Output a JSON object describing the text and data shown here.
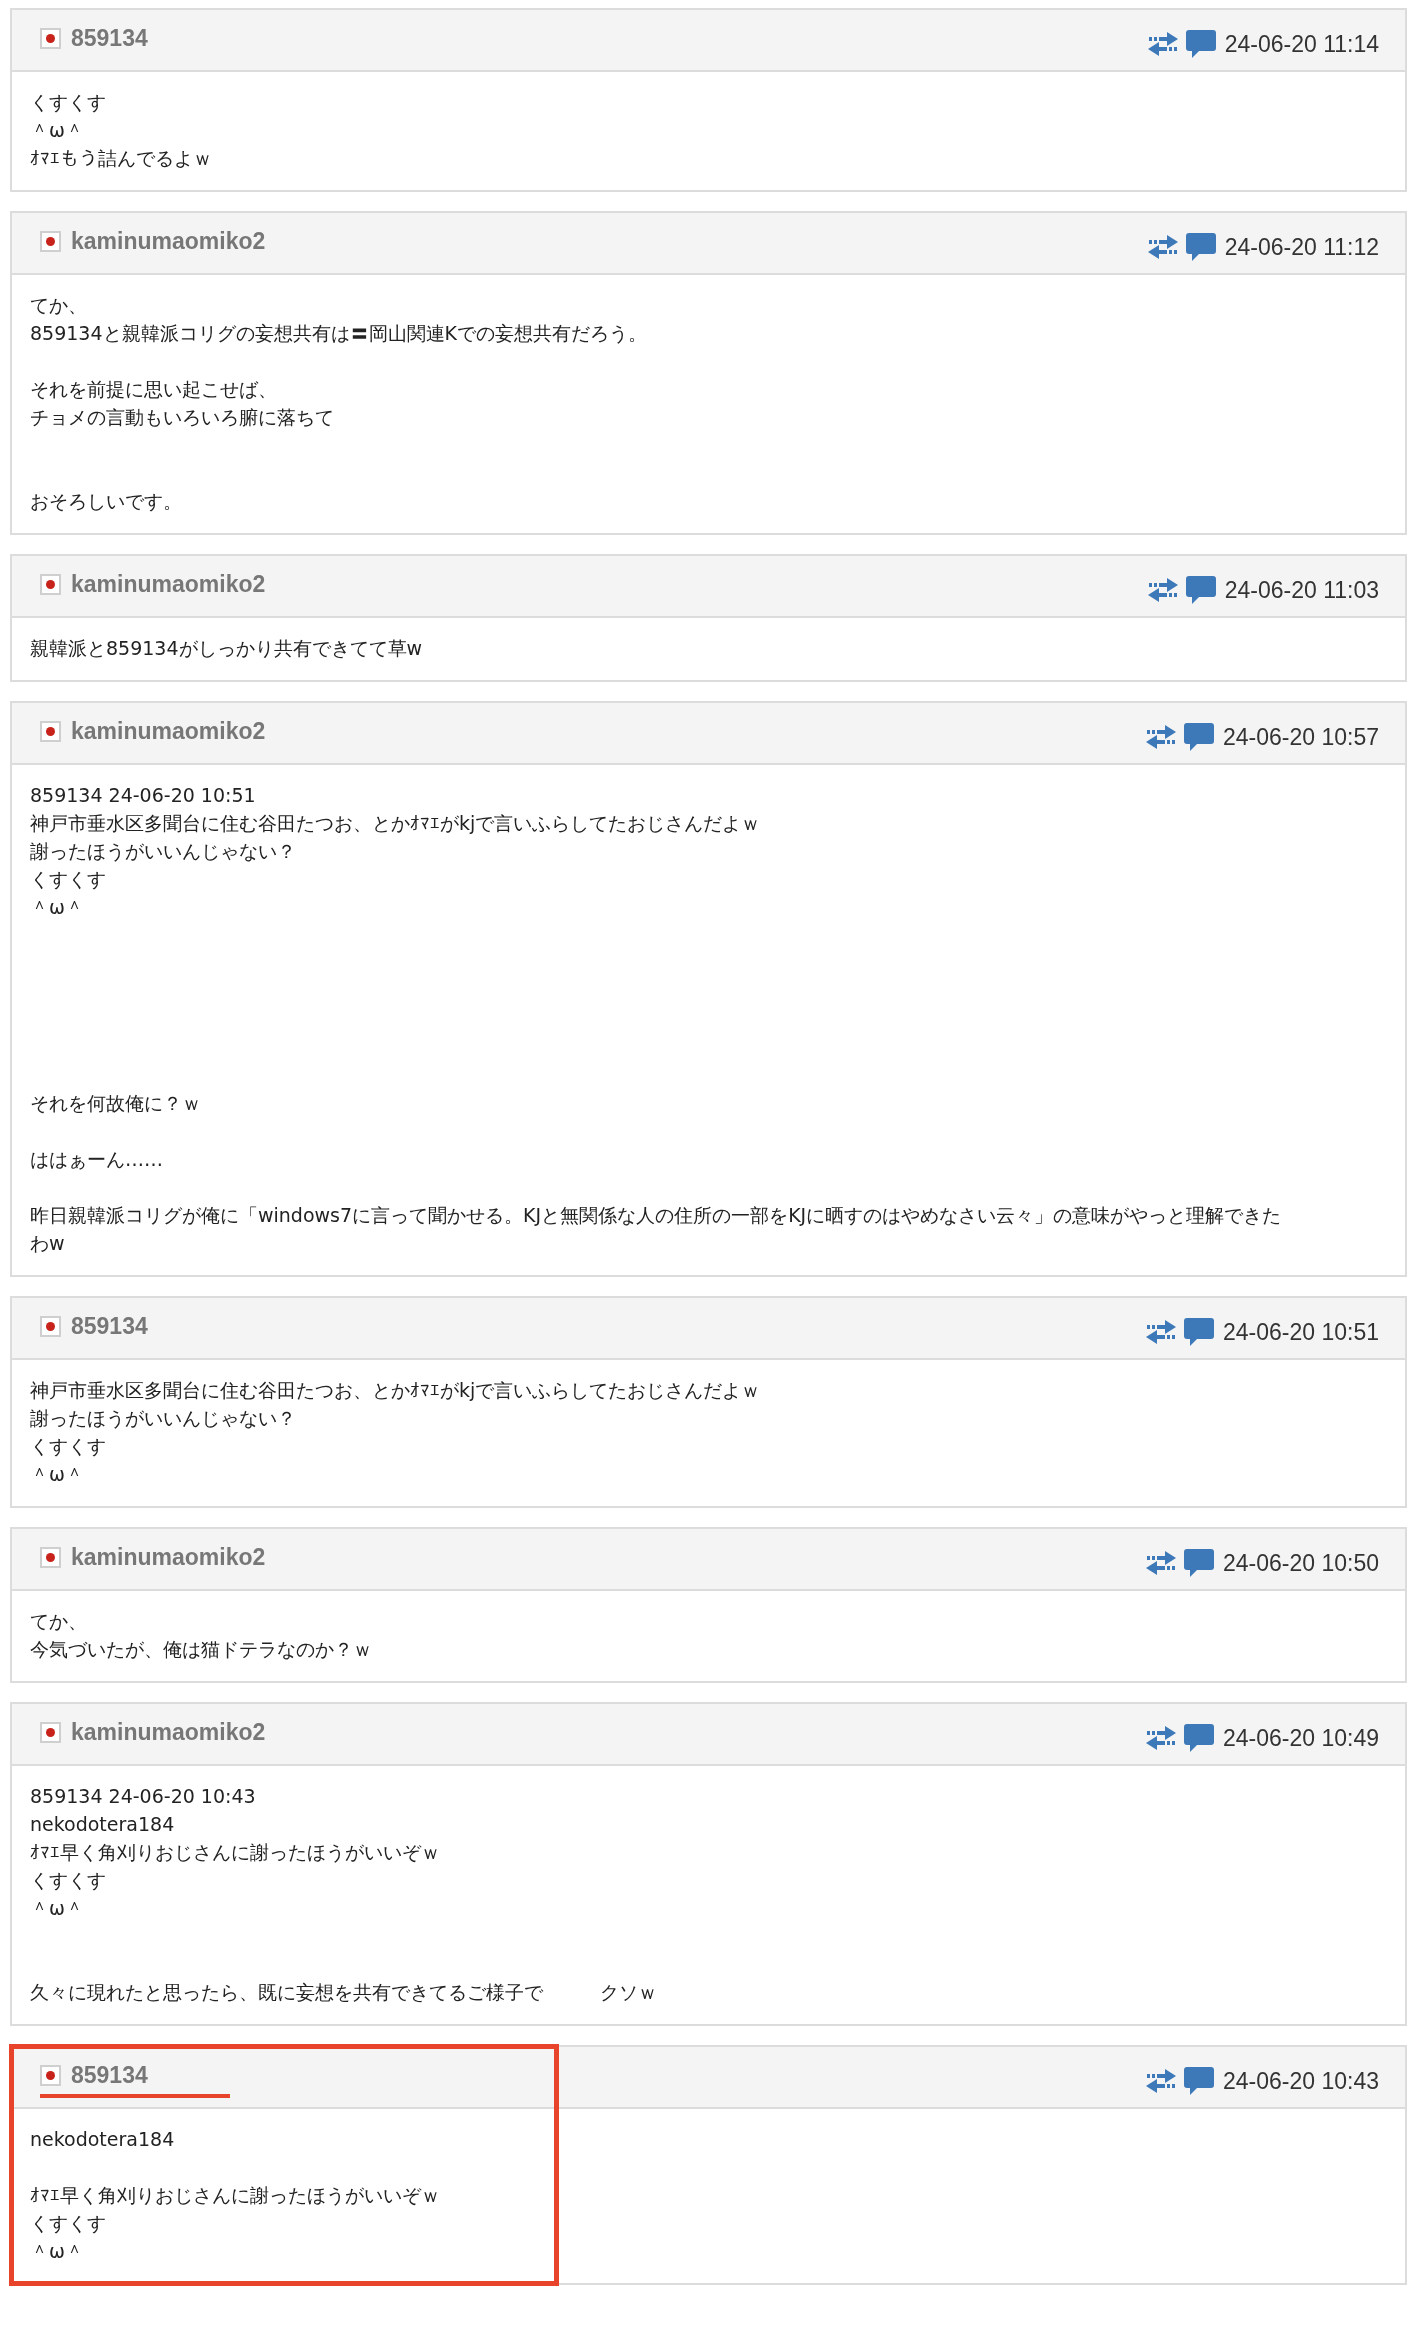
{
  "posts": [
    {
      "user": "859134",
      "date": "24-06-20 11:14",
      "highlighted": false,
      "lines": [
        {
          "kind": "text",
          "text": "くすくす"
        },
        {
          "kind": "text",
          "text": "＾ω＾"
        },
        {
          "kind": "text",
          "text": "ｵﾏｴもう詰んでるよｗ"
        }
      ]
    },
    {
      "user": "kaminumaomiko2",
      "date": "24-06-20 11:12",
      "highlighted": false,
      "lines": [
        {
          "kind": "text",
          "text": "てか、"
        },
        {
          "kind": "text",
          "text": "859134と親韓派コリグの妄想共有は〓岡山関連Kでの妄想共有だろう。"
        },
        {
          "kind": "blank"
        },
        {
          "kind": "text",
          "text": "それを前提に思い起こせば、"
        },
        {
          "kind": "text",
          "text": "チョメの言動もいろいろ腑に落ちて"
        },
        {
          "kind": "blank"
        },
        {
          "kind": "blank"
        },
        {
          "kind": "text",
          "text": "おそろしいです。"
        }
      ]
    },
    {
      "user": "kaminumaomiko2",
      "date": "24-06-20 11:03",
      "highlighted": false,
      "lines": [
        {
          "kind": "text",
          "text": "親韓派と859134がしっかり共有できてて草w"
        }
      ]
    },
    {
      "user": "kaminumaomiko2",
      "date": "24-06-20 10:57",
      "highlighted": false,
      "lines": [
        {
          "kind": "text",
          "text": "859134 24-06-20 10:51"
        },
        {
          "kind": "text",
          "text": "神戸市垂水区多聞台に住む谷田たつお、とかｵﾏｴがkjで言いふらしてたおじさんだよｗ"
        },
        {
          "kind": "text",
          "text": "謝ったほうがいいんじゃない？"
        },
        {
          "kind": "text",
          "text": "くすくす"
        },
        {
          "kind": "text",
          "text": "＾ω＾"
        },
        {
          "kind": "blank"
        },
        {
          "kind": "blank"
        },
        {
          "kind": "blank"
        },
        {
          "kind": "blank"
        },
        {
          "kind": "blank"
        },
        {
          "kind": "blank"
        },
        {
          "kind": "text",
          "text": "それを何故俺に？ｗ"
        },
        {
          "kind": "blank"
        },
        {
          "kind": "text",
          "text": "ははぁーん……"
        },
        {
          "kind": "blank"
        },
        {
          "kind": "text",
          "text": "昨日親韓派コリグが俺に「windows7に言って聞かせる。KJと無関係な人の住所の一部をKJに晒すのはやめなさい云々」の意味がやっと理解できたわw"
        }
      ]
    },
    {
      "user": "859134",
      "date": "24-06-20 10:51",
      "highlighted": false,
      "lines": [
        {
          "kind": "text",
          "text": "神戸市垂水区多聞台に住む谷田たつお、とかｵﾏｴがkjで言いふらしてたおじさんだよｗ"
        },
        {
          "kind": "text",
          "text": "謝ったほうがいいんじゃない？"
        },
        {
          "kind": "text",
          "text": "くすくす"
        },
        {
          "kind": "text",
          "text": "＾ω＾"
        }
      ]
    },
    {
      "user": "kaminumaomiko2",
      "date": "24-06-20 10:50",
      "highlighted": false,
      "lines": [
        {
          "kind": "text",
          "text": "てか、"
        },
        {
          "kind": "text",
          "text": "今気づいたが、俺は猫ドテラなのか？ｗ"
        }
      ]
    },
    {
      "user": "kaminumaomiko2",
      "date": "24-06-20 10:49",
      "highlighted": false,
      "lines": [
        {
          "kind": "text",
          "text": "859134 24-06-20 10:43"
        },
        {
          "kind": "text",
          "text": "nekodotera184"
        },
        {
          "kind": "text",
          "text": "ｵﾏｴ早く角刈りおじさんに謝ったほうがいいぞｗ"
        },
        {
          "kind": "text",
          "text": "くすくす"
        },
        {
          "kind": "text",
          "text": "＾ω＾"
        },
        {
          "kind": "blank"
        },
        {
          "kind": "blank"
        },
        {
          "kind": "text",
          "text": "久々に現れたと思ったら、既に妄想を共有できてるご様子で　　　クソｗ"
        }
      ]
    },
    {
      "user": "859134",
      "date": "24-06-20 10:43",
      "highlighted": true,
      "lines": [
        {
          "kind": "text",
          "text": "nekodotera184"
        },
        {
          "kind": "blank"
        },
        {
          "kind": "text",
          "text": "ｵﾏｴ早く角刈りおじさんに謝ったほうがいいぞｗ"
        },
        {
          "kind": "text",
          "text": "くすくす"
        },
        {
          "kind": "text",
          "text": "＾ω＾"
        }
      ]
    }
  ]
}
